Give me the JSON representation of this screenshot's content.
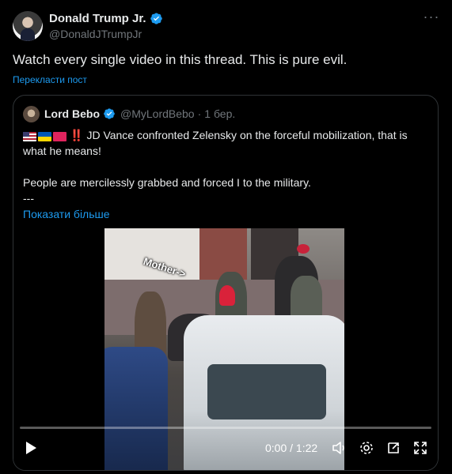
{
  "author": {
    "display_name": "Donald Trump Jr.",
    "handle": "@DonaldJTrumpJr",
    "verified_color": "#1d9bf0"
  },
  "post": {
    "text": "Watch every single video in this thread. This is pure evil.",
    "translate_label": "Перекласти пост",
    "more_icon": "more-horizontal-icon"
  },
  "quote": {
    "display_name": "Lord Bebo",
    "handle": "@MyLordBebo",
    "separator": "·",
    "date": "1 бер.",
    "emoji_prefix": [
      "flag-us",
      "flag-ua",
      "red-emblem"
    ],
    "exclamation": "‼️",
    "line1": "JD Vance confronted Zelensky on the forceful mobilization, that is what he means!",
    "line2": "People are mercilessly grabbed and forced I to the military.",
    "dash": "---",
    "show_more_label": "Показати більше"
  },
  "video": {
    "overlay_text": "Mother->",
    "time": "0:00 / 1:22",
    "progress": 0.0,
    "controls": [
      "play-icon",
      "volume-icon",
      "settings-icon",
      "pip-icon",
      "fullscreen-icon"
    ]
  }
}
